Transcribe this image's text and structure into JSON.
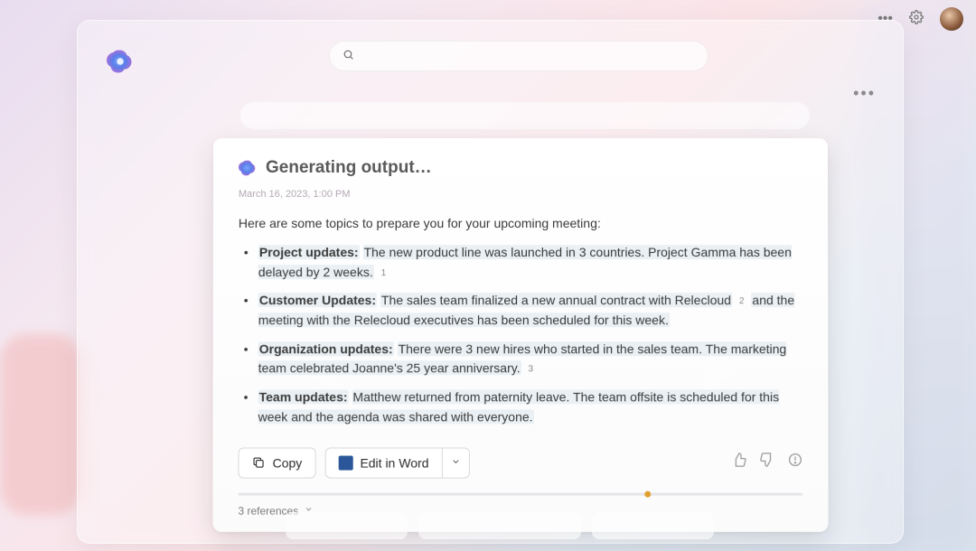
{
  "global": {
    "more_label": "More",
    "settings_label": "Settings",
    "avatar_label": "User avatar"
  },
  "window": {
    "search_placeholder": "",
    "more_label": "More options"
  },
  "card": {
    "title": "Generating output…",
    "timestamp": "March 16, 2023, 1:00 PM",
    "intro": "Here are some topics to prepare you for your upcoming meeting:",
    "topics": [
      {
        "key": "Project updates:",
        "text": "The new product line was launched in 3 countries. Project Gamma has been delayed by 2 weeks.",
        "ref": "1"
      },
      {
        "key": "Customer Updates:",
        "text_a": "The sales team finalized a new annual contract with Relecloud",
        "ref": "2",
        "text_b": "and the meeting with the Relecloud executives has been scheduled for this week."
      },
      {
        "key": "Organization updates:",
        "text": "There were 3 new hires who started in the sales team. The marketing team celebrated Joanne's 25 year anniversary.",
        "ref": "3"
      },
      {
        "key": "Team updates:",
        "text": "Matthew returned from paternity leave. The team offsite is scheduled for this week and the agenda was shared with everyone."
      }
    ],
    "actions": {
      "copy": "Copy",
      "edit_in_word": "Edit in Word"
    },
    "references": {
      "label": "3 references"
    },
    "feedback": {
      "like": "Like",
      "dislike": "Dislike",
      "report": "Report"
    }
  }
}
